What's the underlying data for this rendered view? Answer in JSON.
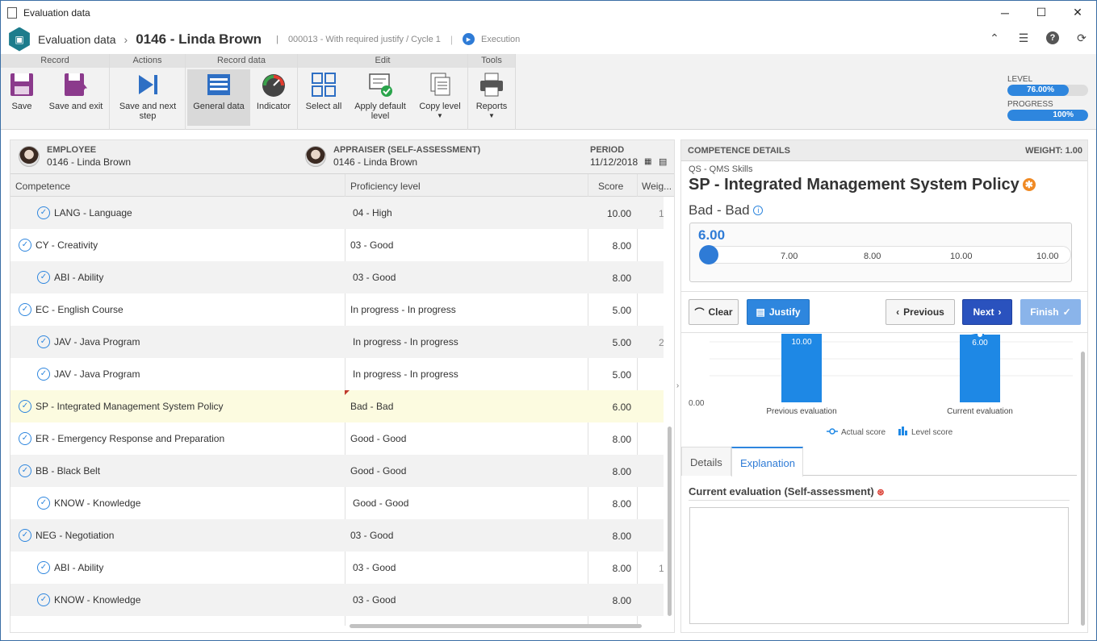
{
  "window": {
    "title": "Evaluation data",
    "minimize": "─",
    "maximize": "☐",
    "close": "✕"
  },
  "appbar": {
    "section": "Evaluation data",
    "record": "0146 - Linda Brown",
    "context": "000013 - With required justify / Cycle 1",
    "status": "Execution",
    "icons": [
      "collapse-icon",
      "list-icon",
      "help-icon",
      "refresh-icon"
    ]
  },
  "ribbon": {
    "groups": {
      "record": "Record",
      "actions": "Actions",
      "record_data": "Record data",
      "edit": "Edit",
      "tools": "Tools"
    },
    "buttons": {
      "save": "Save",
      "save_exit": "Save and exit",
      "save_next_1": "Save and next",
      "save_next_2": "step",
      "general_data": "General data",
      "indicator": "Indicator",
      "select_all": "Select all",
      "apply_default_1": "Apply default",
      "apply_default_2": "level",
      "copy_level": "Copy level",
      "reports": "Reports"
    },
    "level": {
      "label": "LEVEL",
      "value": "76.00%",
      "percent": 76
    },
    "progress": {
      "label": "PROGRESS",
      "value": "100%",
      "percent": 100
    }
  },
  "employee": {
    "employee_label": "EMPLOYEE",
    "employee_value": "0146 - Linda Brown",
    "appraiser_label": "APPRAISER (SELF-ASSESSMENT)",
    "appraiser_value": "0146 - Linda Brown",
    "period_label": "PERIOD",
    "period_value": "11/12/2018"
  },
  "table": {
    "columns": {
      "competence": "Competence",
      "proficiency": "Proficiency level",
      "score": "Score",
      "weight": "Weig..."
    },
    "rows": [
      {
        "name": "LANG - Language",
        "level": "04 - High",
        "score": "10.00",
        "weight": "1",
        "indent": true
      },
      {
        "name": "CY - Creativity",
        "level": "03 - Good",
        "score": "8.00",
        "weight": "",
        "indent": false
      },
      {
        "name": "ABI - Ability",
        "level": "03 - Good",
        "score": "8.00",
        "weight": "",
        "indent": true
      },
      {
        "name": "EC - English Course",
        "level": "In progress - In progress",
        "score": "5.00",
        "weight": "",
        "indent": false
      },
      {
        "name": "JAV - Java Program",
        "level": "In progress - In progress",
        "score": "5.00",
        "weight": "2",
        "indent": true
      },
      {
        "name": "JAV - Java Program",
        "level": "In progress - In progress",
        "score": "5.00",
        "weight": "",
        "indent": true
      },
      {
        "name": "SP - Integrated Management System Policy",
        "level": "Bad - Bad",
        "score": "6.00",
        "weight": "",
        "indent": false,
        "selected": true
      },
      {
        "name": "ER - Emergency Response and Preparation",
        "level": "Good - Good",
        "score": "8.00",
        "weight": "",
        "indent": false
      },
      {
        "name": "BB - Black Belt",
        "level": "Good - Good",
        "score": "8.00",
        "weight": "",
        "indent": false
      },
      {
        "name": "KNOW - Knowledge",
        "level": "Good - Good",
        "score": "8.00",
        "weight": "",
        "indent": true
      },
      {
        "name": "NEG - Negotiation",
        "level": "03 - Good",
        "score": "8.00",
        "weight": "",
        "indent": false
      },
      {
        "name": "ABI - Ability",
        "level": "03 - Good",
        "score": "8.00",
        "weight": "1",
        "indent": true
      },
      {
        "name": "KNOW - Knowledge",
        "level": "03 - Good",
        "score": "8.00",
        "weight": "",
        "indent": true
      }
    ]
  },
  "details": {
    "header": "COMPETENCE DETAILS",
    "weight": "WEIGHT: 1.00",
    "category": "QS - QMS Skills",
    "title": "SP - Integrated Management System Policy",
    "level": "Bad - Bad",
    "slider_value": "6.00",
    "slider_ticks": [
      "7.00",
      "8.00",
      "10.00",
      "10.00"
    ],
    "buttons": {
      "clear": "Clear",
      "justify": "Justify",
      "previous": "Previous",
      "next": "Next",
      "finish": "Finish"
    },
    "tabs": {
      "details": "Details",
      "explanation": "Explanation"
    },
    "current_label": "Current evaluation (Self-assessment)"
  },
  "chart_data": {
    "type": "bar",
    "categories": [
      "Previous evaluation",
      "Current evaluation"
    ],
    "series": [
      {
        "name": "Actual score",
        "values": [
          10.0,
          6.0
        ],
        "kind": "line"
      },
      {
        "name": "Level score",
        "values": [
          10.0,
          6.0
        ],
        "kind": "bar"
      }
    ],
    "data_labels": [
      "10.00",
      "6.00"
    ],
    "ytick": "0.00",
    "ylim": [
      0,
      10
    ],
    "legend": "bottom",
    "colors": {
      "bar": "#1e88e5",
      "line": "#1e88e5"
    }
  }
}
